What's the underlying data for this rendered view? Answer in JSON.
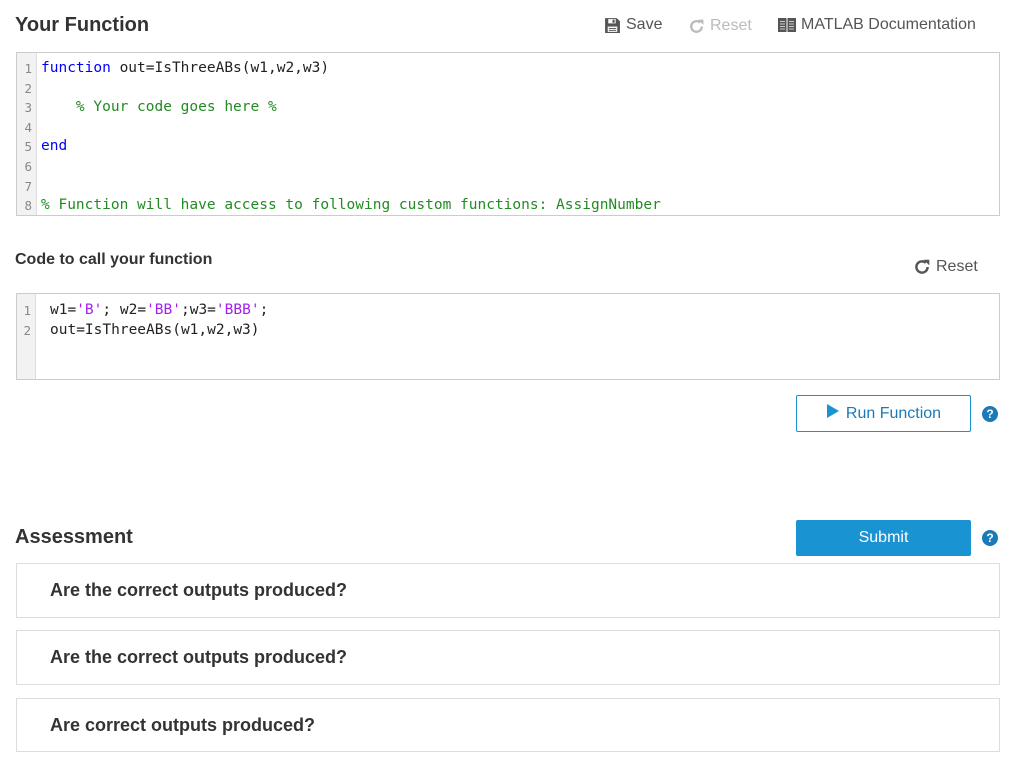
{
  "function_section": {
    "title": "Your Function",
    "toolbar": {
      "save_label": "Save",
      "reset_label": "Reset",
      "docs_label": "MATLAB Documentation"
    },
    "editor": {
      "line_numbers": [
        "1",
        "2",
        "3",
        "4",
        "5",
        "6",
        "7",
        "8"
      ],
      "lines": [
        [
          {
            "t": "function",
            "c": "kw"
          },
          {
            "t": " out=IsThreeABs(w1,w2,w3)",
            "c": ""
          }
        ],
        [],
        [
          {
            "t": "    % Your code goes here %",
            "c": "cm"
          }
        ],
        [],
        [
          {
            "t": "end",
            "c": "kw"
          }
        ],
        [],
        [],
        [
          {
            "t": "% Function will have access to following custom functions: AssignNumber",
            "c": "cm"
          }
        ]
      ]
    }
  },
  "call_section": {
    "title": "Code to call your function",
    "reset_label": "Reset",
    "editor": {
      "line_numbers": [
        "1",
        "2"
      ],
      "lines": [
        [
          {
            "t": "w1=",
            "c": ""
          },
          {
            "t": "'B'",
            "c": "str"
          },
          {
            "t": "; w2=",
            "c": ""
          },
          {
            "t": "'BB'",
            "c": "str"
          },
          {
            "t": ";w3=",
            "c": ""
          },
          {
            "t": "'BBB'",
            "c": "str"
          },
          {
            "t": ";",
            "c": ""
          }
        ],
        [
          {
            "t": "out=IsThreeABs(w1,w2,w3)",
            "c": ""
          }
        ]
      ]
    },
    "run_label": "Run Function",
    "help_glyph": "?"
  },
  "assessment": {
    "title": "Assessment",
    "submit_label": "Submit",
    "help_glyph": "?",
    "items": [
      {
        "label": "Are the correct outputs produced?"
      },
      {
        "label": "Are the correct outputs produced?"
      },
      {
        "label": "Are correct outputs produced?"
      }
    ]
  },
  "colors": {
    "accent": "#1a93d2",
    "keyword": "#0000ff",
    "comment": "#228b22",
    "string": "#a020f0"
  }
}
